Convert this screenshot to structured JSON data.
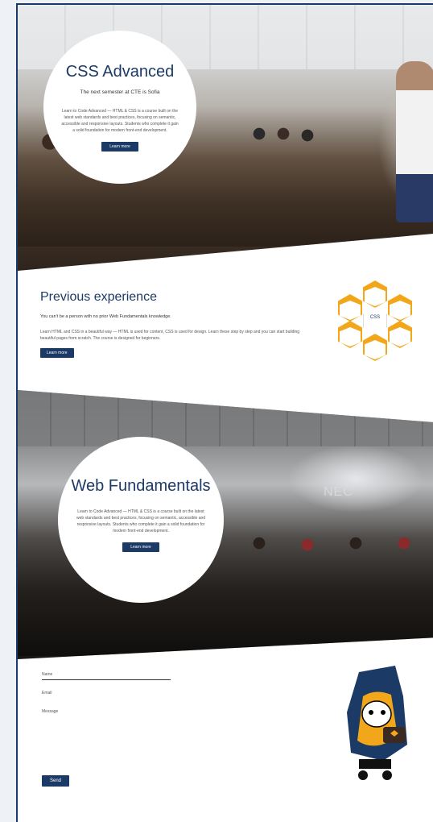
{
  "hero": {
    "title": "CSS Advanced",
    "subtitle": "The next semester at CTE is Sofia",
    "body": "Learn to Code Advanced — HTML & CSS is a course built on the latest web standards and best practices, focusing on semantic, accessible and responsive layouts. Students who complete it gain a solid foundation for modern front-end development.",
    "button": "Learn more"
  },
  "previous": {
    "title": "Previous experience",
    "lead": "You can't be a person with no prior Web Fundamentals knowledge.",
    "desc": "Learn HTML and CSS in a beautiful way — HTML is used for content, CSS is used for design. Learn these step by step and you can start building beautiful pages from scratch. The course is designed for beginners.",
    "button": "Learn more",
    "infographic": {
      "center_label": "CSS"
    }
  },
  "web": {
    "title": "Web Fundamentals",
    "body": "Learn to Code Advanced — HTML & CSS is a course built on the latest web standards and best practices, focusing on semantic, accessible and responsive layouts. Students who complete it gain a solid foundation for modern front-end development.",
    "button": "Learn more",
    "screen_text": "NEC"
  },
  "contact": {
    "name_placeholder": "Name",
    "email_placeholder": "Email",
    "message_placeholder": "Message",
    "send_label": "Send"
  },
  "colors": {
    "brand_navy": "#1c3a66",
    "accent_orange": "#f2a71b"
  }
}
